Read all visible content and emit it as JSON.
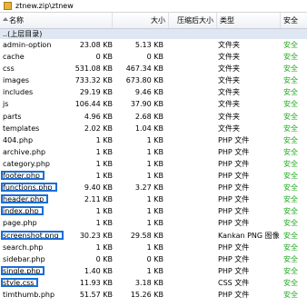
{
  "path": "ztnew.zip\\ztnew",
  "columns": {
    "name": "名称",
    "size": "大小",
    "compressed": "压缩后大小",
    "type": "类型",
    "safety": "安全"
  },
  "parent_label": "..(上层目录)",
  "accent_color": "#1a6ed8",
  "safe_color": "#1fa81f",
  "files": [
    {
      "name": "admin-option",
      "size": "23.08 KB",
      "compressed": "5.13 KB",
      "type": "文件夹",
      "safety": "安全",
      "highlighted": false
    },
    {
      "name": "cache",
      "size": "0 KB",
      "compressed": "0 KB",
      "type": "文件夹",
      "safety": "安全",
      "highlighted": false
    },
    {
      "name": "css",
      "size": "531.08 KB",
      "compressed": "467.34 KB",
      "type": "文件夹",
      "safety": "安全",
      "highlighted": false
    },
    {
      "name": "images",
      "size": "733.32 KB",
      "compressed": "673.80 KB",
      "type": "文件夹",
      "safety": "安全",
      "highlighted": false
    },
    {
      "name": "includes",
      "size": "29.19 KB",
      "compressed": "9.46 KB",
      "type": "文件夹",
      "safety": "安全",
      "highlighted": false
    },
    {
      "name": "js",
      "size": "106.44 KB",
      "compressed": "37.90 KB",
      "type": "文件夹",
      "safety": "安全",
      "highlighted": false
    },
    {
      "name": "parts",
      "size": "4.96 KB",
      "compressed": "2.68 KB",
      "type": "文件夹",
      "safety": "安全",
      "highlighted": false
    },
    {
      "name": "templates",
      "size": "2.02 KB",
      "compressed": "1.04 KB",
      "type": "文件夹",
      "safety": "安全",
      "highlighted": false
    },
    {
      "name": "404.php",
      "size": "1 KB",
      "compressed": "1 KB",
      "type": "PHP 文件",
      "safety": "安全",
      "highlighted": false
    },
    {
      "name": "archive.php",
      "size": "1 KB",
      "compressed": "1 KB",
      "type": "PHP 文件",
      "safety": "安全",
      "highlighted": false
    },
    {
      "name": "category.php",
      "size": "1 KB",
      "compressed": "1 KB",
      "type": "PHP 文件",
      "safety": "安全",
      "highlighted": false
    },
    {
      "name": "footer.php",
      "size": "1 KB",
      "compressed": "1 KB",
      "type": "PHP 文件",
      "safety": "安全",
      "highlighted": true
    },
    {
      "name": "functions.php",
      "size": "9.40 KB",
      "compressed": "3.27 KB",
      "type": "PHP 文件",
      "safety": "安全",
      "highlighted": true
    },
    {
      "name": "header.php",
      "size": "2.11 KB",
      "compressed": "1 KB",
      "type": "PHP 文件",
      "safety": "安全",
      "highlighted": true
    },
    {
      "name": "index.php",
      "size": "1 KB",
      "compressed": "1 KB",
      "type": "PHP 文件",
      "safety": "安全",
      "highlighted": true
    },
    {
      "name": "page.php",
      "size": "1 KB",
      "compressed": "1 KB",
      "type": "PHP 文件",
      "safety": "安全",
      "highlighted": false
    },
    {
      "name": "screenshot.png",
      "size": "30.23 KB",
      "compressed": "29.58 KB",
      "type": "Kankan PNG 图像",
      "safety": "安全",
      "highlighted": true
    },
    {
      "name": "search.php",
      "size": "1 KB",
      "compressed": "1 KB",
      "type": "PHP 文件",
      "safety": "安全",
      "highlighted": false
    },
    {
      "name": "sidebar.php",
      "size": "0 KB",
      "compressed": "0 KB",
      "type": "PHP 文件",
      "safety": "安全",
      "highlighted": false
    },
    {
      "name": "single.php",
      "size": "1.40 KB",
      "compressed": "1 KB",
      "type": "PHP 文件",
      "safety": "安全",
      "highlighted": true
    },
    {
      "name": "style.css",
      "size": "11.93 KB",
      "compressed": "3.18 KB",
      "type": "CSS 文件",
      "safety": "安全",
      "highlighted": true
    },
    {
      "name": "timthumb.php",
      "size": "51.57 KB",
      "compressed": "15.26 KB",
      "type": "PHP 文件",
      "safety": "安全",
      "highlighted": false
    }
  ]
}
